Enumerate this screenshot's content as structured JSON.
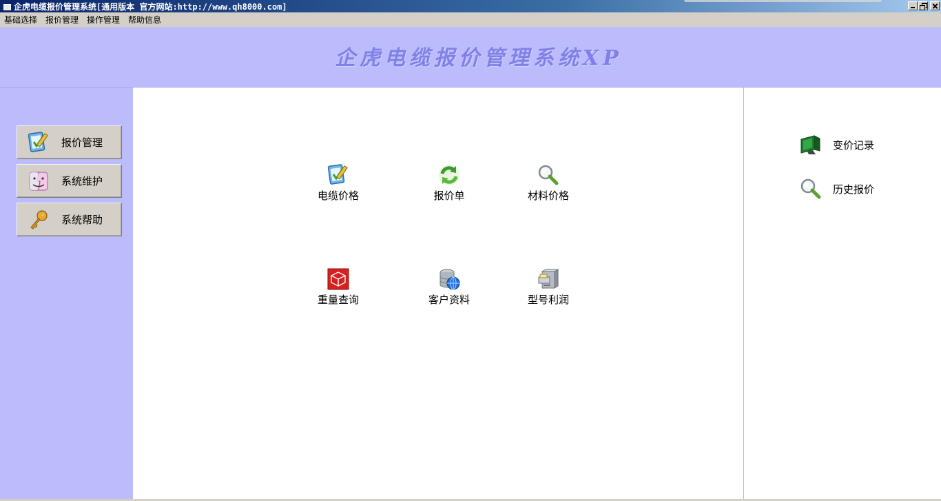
{
  "window": {
    "title": "企虎电缆报价管理系统[通用版本 官方网站:http://www.qh8000.com]"
  },
  "menubar": {
    "items": [
      "基础选择",
      "报价管理",
      "操作管理",
      "帮助信息"
    ]
  },
  "banner": {
    "title": "企虎电缆报价管理系统XP"
  },
  "left_nav": {
    "items": [
      {
        "label": "报价管理",
        "icon": "notepad-pencil-icon"
      },
      {
        "label": "系统维护",
        "icon": "finder-face-icon"
      },
      {
        "label": "系统帮助",
        "icon": "key-icon"
      }
    ]
  },
  "center": {
    "tiles": [
      {
        "label": "电缆价格",
        "icon": "notepad-pencil-icon"
      },
      {
        "label": "报价单",
        "icon": "refresh-arrows-icon"
      },
      {
        "label": "材料价格",
        "icon": "magnifier-icon"
      },
      {
        "label": "重量查询",
        "icon": "red-cube-icon"
      },
      {
        "label": "客户资料",
        "icon": "database-globe-icon"
      },
      {
        "label": "型号利润",
        "icon": "file-cabinet-icon"
      }
    ]
  },
  "right": {
    "items": [
      {
        "label": "变价记录",
        "icon": "green-monitor-icon"
      },
      {
        "label": "历史报价",
        "icon": "magnifier-icon"
      }
    ]
  },
  "colors": {
    "panel_bg": "#bcbcfc",
    "banner_text": "#8080e8",
    "button_face": "#d4d0c8"
  }
}
